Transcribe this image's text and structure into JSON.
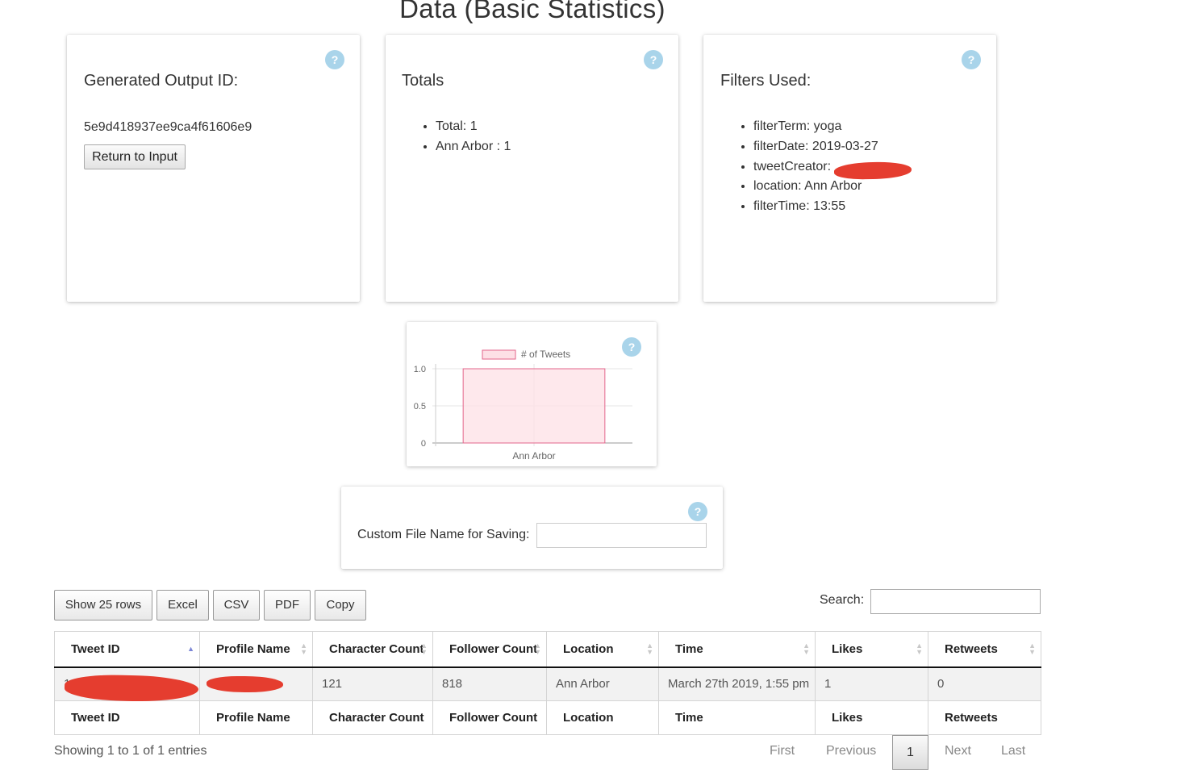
{
  "page": {
    "title": "Data (Basic Statistics)"
  },
  "output_card": {
    "heading": "Generated Output ID:",
    "output_id": "5e9d418937ee9ca4f61606e9",
    "return_button": "Return to Input"
  },
  "totals_card": {
    "heading": "Totals",
    "items": [
      "Total: 1",
      "Ann Arbor : 1"
    ]
  },
  "filters_card": {
    "heading": "Filters Used:",
    "items": [
      "filterTerm: yoga",
      "filterDate: 2019-03-27",
      "tweetCreator:",
      "location: Ann Arbor",
      "filterTime: 13:55"
    ]
  },
  "help_icon": {
    "glyph": "?",
    "icon": "question-circle-icon",
    "color": "#a9d4ea"
  },
  "chart_data": {
    "type": "bar",
    "categories": [
      "Ann Arbor"
    ],
    "series": [
      {
        "name": "# of Tweets",
        "values": [
          1
        ]
      }
    ],
    "ylim": [
      0,
      1
    ],
    "yticks": [
      "1.0",
      "0.5",
      "0"
    ],
    "legend": "top",
    "grid": true,
    "fill_color": "#fde0e6",
    "stroke_color": "#e3668b"
  },
  "save_card": {
    "label": "Custom File Name for Saving:",
    "value": ""
  },
  "toolbar": {
    "show_rows": "Show 25 rows",
    "excel": "Excel",
    "csv": "CSV",
    "pdf": "PDF",
    "copy": "Copy",
    "search_label": "Search:",
    "search_value": ""
  },
  "table": {
    "columns": [
      "Tweet ID",
      "Profile Name",
      "Character Count",
      "Follower Count",
      "Location",
      "Time",
      "Likes",
      "Retweets"
    ],
    "rows": [
      [
        "111",
        "",
        "121",
        "818",
        "Ann Arbor",
        "March 27th 2019, 1:55 pm",
        "1",
        "0"
      ]
    ]
  },
  "footer": {
    "info": "Showing 1 to 1 of 1 entries",
    "pagination": {
      "first": "First",
      "previous": "Previous",
      "current": "1",
      "next": "Next",
      "last": "Last"
    }
  }
}
